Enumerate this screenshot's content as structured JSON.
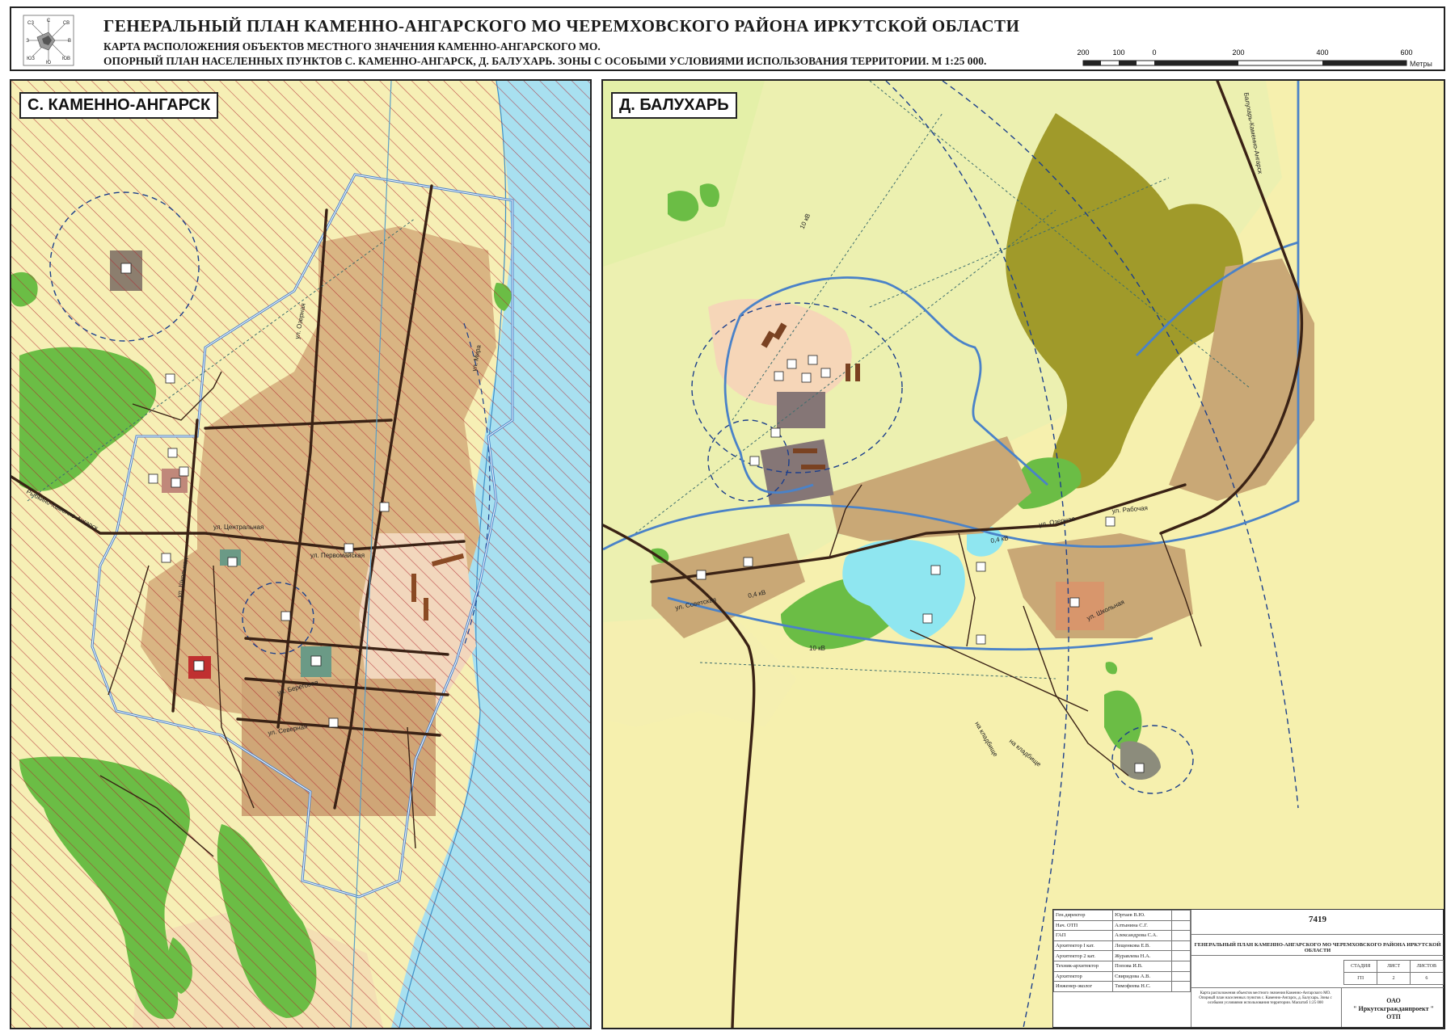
{
  "header": {
    "title": "ГЕНЕРАЛЬНЫЙ ПЛАН КАМЕННО-АНГАРСКОГО МО ЧЕРЕМХОВСКОГО РАЙОНА ИРКУТСКОЙ ОБЛАСТИ",
    "subtitle_1": "КАРТА РАСПОЛОЖЕНИЯ ОБЪЕКТОВ МЕСТНОГО ЗНАЧЕНИЯ КАМЕННО-АНГАРСКОГО МО.",
    "subtitle_2": "ОПОРНЫЙ ПЛАН НАСЕЛЕННЫХ ПУНКТОВ С. КАМЕННО-АНГАРСК, Д. БАЛУХАРЬ. ЗОНЫ С ОСОБЫМИ УСЛОВИЯМИ ИСПОЛЬЗОВАНИЯ ТЕРРИТОРИИ. М 1:25 000."
  },
  "compass": {
    "labels": [
      "С",
      "СВ",
      "В",
      "ЮВ",
      "Ю",
      "ЮЗ",
      "З",
      "СЗ"
    ]
  },
  "scale_bar": {
    "ticks": [
      "200",
      "100",
      "0",
      "200",
      "400",
      "600"
    ],
    "unit": "Метры"
  },
  "map_left": {
    "label": "С. КАМЕННО-АНГАРСК",
    "streets": [
      "ул. Озерная",
      "ул. Береговая",
      "ул. Центральная",
      "ул. Первомайская",
      "ул. Школьная",
      "ул. Мира",
      "ул. Северная",
      "Рыбкино-Каменно-Ангарск"
    ]
  },
  "map_right": {
    "label": "Д. БАЛУХАРЬ",
    "streets": [
      "ул. Рабочая",
      "ул. Озерная",
      "ул. Советская",
      "ул. Школьная",
      "Балухарь-Каменно-Ангарск",
      "на кладбище",
      "на кладбище"
    ],
    "power_lines": [
      "10 кВ",
      "10 кВ",
      "0,4 кВ",
      "0,4 кВ"
    ]
  },
  "stamp": {
    "staff": [
      {
        "role": "Ген.директор",
        "name": "Юртаев В.Ю."
      },
      {
        "role": "Нач. ОТП",
        "name": "Алтынина С.Г."
      },
      {
        "role": "ГАП",
        "name": "Александрова С.А."
      },
      {
        "role": "Архитектор I кат.",
        "name": "Лещенкова Е.В."
      },
      {
        "role": "Архитектор 2 кат.",
        "name": "Журавлева Н.А."
      },
      {
        "role": "Техник-архитектор",
        "name": "Попова И.В."
      },
      {
        "role": "Архитектор",
        "name": "Свиридова А.В."
      },
      {
        "role": "Инженер-эколог",
        "name": "Тимофеева Н.С."
      }
    ],
    "code": "7419",
    "project": "ГЕНЕРАЛЬНЫЙ ПЛАН КАМЕННО-АНГАРСКОГО МО ЧЕРЕМХОВСКОГО РАЙОНА ИРКУТСКОЙ ОБЛАСТИ",
    "columns": [
      "СТАДИЯ",
      "ЛИСТ",
      "ЛИСТОВ"
    ],
    "values": [
      "ГП",
      "2",
      "6"
    ],
    "sheet_description": "Карта расположения объектов местного значения Каменно-Ангарского МО. Опорный план населенных пунктов с. Каменно-Ангарск, д. Балухарь. Зоны с особыми условиями использования территории. Масштаб 1:25 000",
    "org_1": "ОАО",
    "org_2": "\" Иркутскгражданпроект \"",
    "org_3": "ОТП"
  }
}
